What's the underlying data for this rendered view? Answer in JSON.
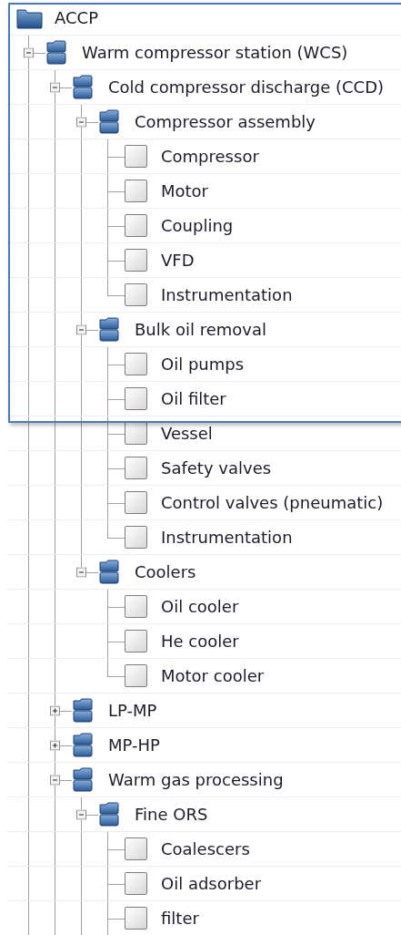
{
  "continues_below": true,
  "tree": [
    {
      "kind": "folder",
      "label": "ACCP",
      "expanded": true,
      "children": [
        {
          "kind": "group",
          "label": "Warm compressor station (WCS)",
          "expanded": true,
          "children": [
            {
              "kind": "group",
              "label": "Cold compressor discharge (CCD)",
              "expanded": true,
              "children": [
                {
                  "kind": "group",
                  "label": "Compressor assembly",
                  "expanded": true,
                  "children": [
                    {
                      "kind": "item",
                      "label": "Compressor",
                      "checked": false
                    },
                    {
                      "kind": "item",
                      "label": "Motor",
                      "checked": false
                    },
                    {
                      "kind": "item",
                      "label": "Coupling",
                      "checked": false
                    },
                    {
                      "kind": "item",
                      "label": "VFD",
                      "checked": false
                    },
                    {
                      "kind": "item",
                      "label": "Instrumentation",
                      "checked": false
                    }
                  ]
                },
                {
                  "kind": "group",
                  "label": "Bulk oil removal",
                  "expanded": true,
                  "children": [
                    {
                      "kind": "item",
                      "label": "Oil pumps",
                      "checked": false
                    },
                    {
                      "kind": "item",
                      "label": "Oil filter",
                      "checked": false
                    },
                    {
                      "kind": "item",
                      "label": "Vessel",
                      "checked": false
                    },
                    {
                      "kind": "item",
                      "label": "Safety valves",
                      "checked": false
                    },
                    {
                      "kind": "item",
                      "label": "Control valves (pneumatic)",
                      "checked": false
                    },
                    {
                      "kind": "item",
                      "label": "Instrumentation",
                      "checked": false
                    }
                  ]
                },
                {
                  "kind": "group",
                  "label": "Coolers",
                  "expanded": true,
                  "children": [
                    {
                      "kind": "item",
                      "label": "Oil cooler",
                      "checked": false
                    },
                    {
                      "kind": "item",
                      "label": "He cooler",
                      "checked": false
                    },
                    {
                      "kind": "item",
                      "label": "Motor cooler",
                      "checked": false
                    }
                  ]
                }
              ]
            },
            {
              "kind": "group",
              "label": "LP-MP",
              "expanded": false
            },
            {
              "kind": "group",
              "label": "MP-HP",
              "expanded": false
            },
            {
              "kind": "group",
              "label": "Warm gas processing",
              "expanded": true,
              "children": [
                {
                  "kind": "group",
                  "label": "Fine ORS",
                  "expanded": true,
                  "children": [
                    {
                      "kind": "item",
                      "label": "Coalescers",
                      "checked": false
                    },
                    {
                      "kind": "item",
                      "label": "Oil adsorber",
                      "checked": false
                    },
                    {
                      "kind": "item",
                      "label": "filter",
                      "checked": false
                    }
                  ]
                }
              ]
            }
          ]
        }
      ]
    }
  ]
}
